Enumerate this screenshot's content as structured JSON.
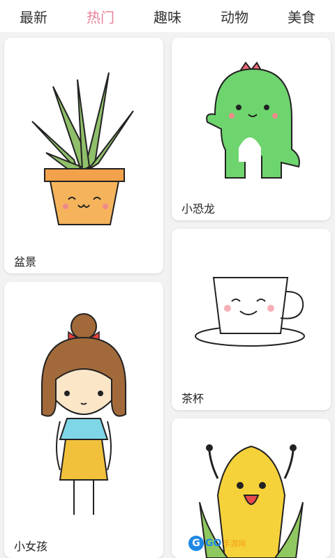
{
  "tabs": [
    {
      "label": "最新"
    },
    {
      "label": "热门"
    },
    {
      "label": "趣味"
    },
    {
      "label": "动物"
    },
    {
      "label": "美食"
    }
  ],
  "active_tab_color": "#e8829a",
  "cards": [
    {
      "label": "盆景",
      "icon": "potted-aloe-plant"
    },
    {
      "label": "小恐龙",
      "icon": "green-dinosaur"
    },
    {
      "label": "小女孩",
      "icon": "little-girl"
    },
    {
      "label": "茶杯",
      "icon": "smiling-teacup"
    },
    {
      "label": "",
      "icon": "smiling-corn"
    }
  ],
  "watermark": {
    "logo": "G",
    "text": "GO",
    "sub": "手游网"
  }
}
